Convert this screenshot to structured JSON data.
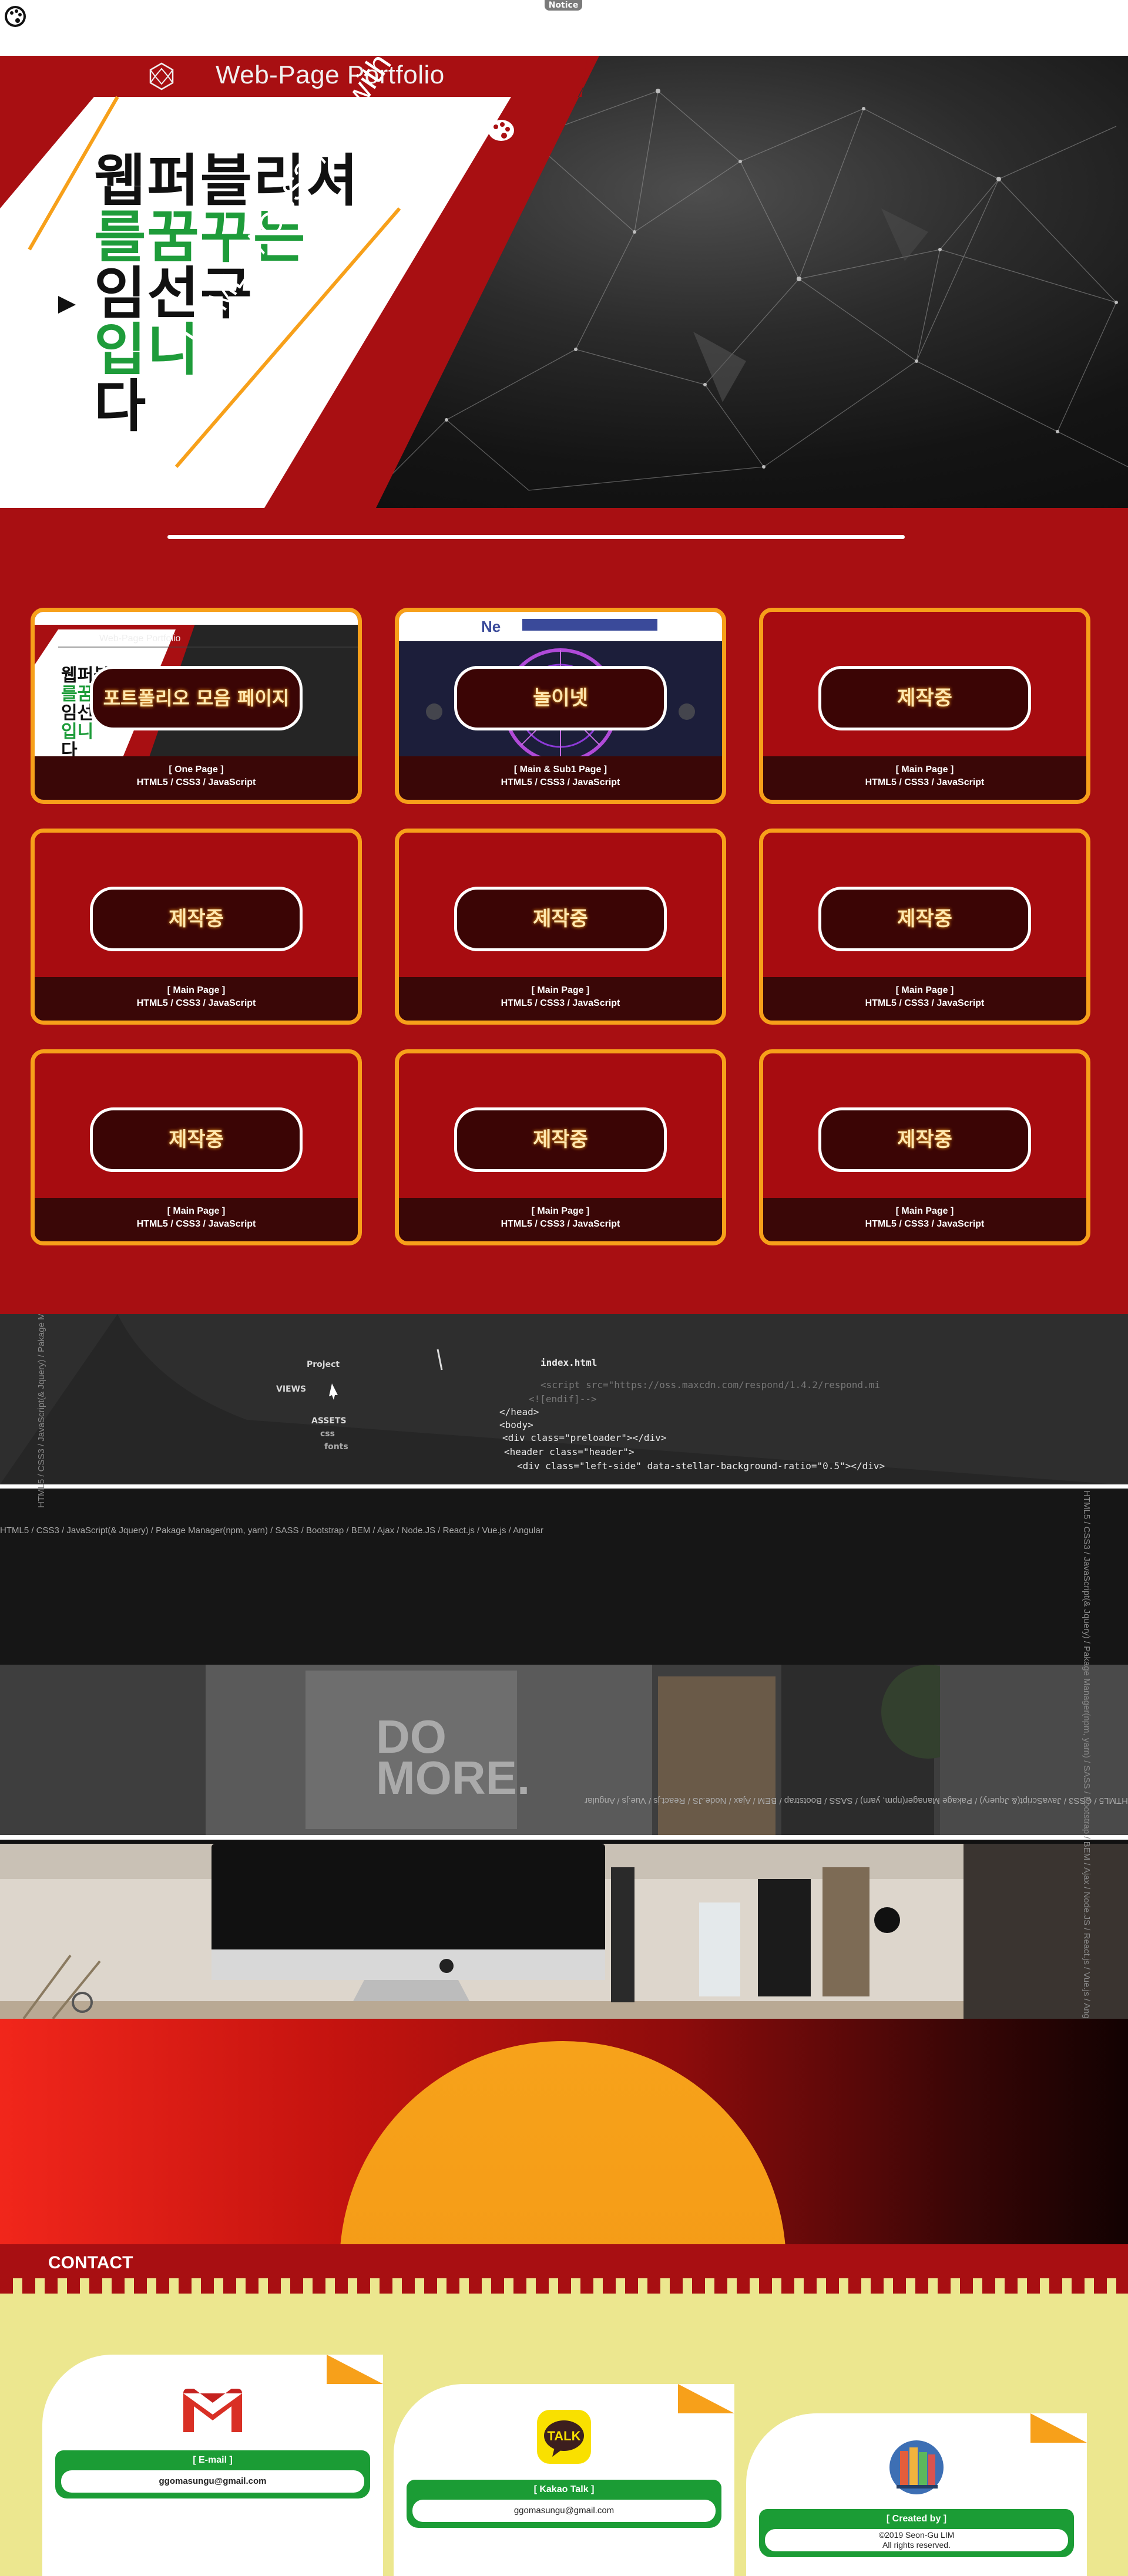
{
  "topbar": {
    "notice_label": "Notice",
    "logo_icon": "palette-icon"
  },
  "hero": {
    "title": "Web-Page Portfolio",
    "title_icon": "geodesic-sphere-icon",
    "headline_lines": [
      "웹퍼블리셔",
      "를꿈꾸는",
      "임선구",
      "입니",
      "다"
    ],
    "tech_stack": "HTML5 / CSS3 / JS(with Jquery)",
    "colors": {
      "red": "#a80f12",
      "green": "#1e9c3a",
      "orange": "#f7a01a"
    }
  },
  "portfolio": {
    "cards": [
      {
        "label": "포트폴리오 모음 페이지",
        "kind": "[ One Page ]",
        "tech": "HTML5 / CSS3 / JavaScript",
        "thumb": "portfolio"
      },
      {
        "label": "놀이넷",
        "kind": "[ Main & Sub1 Page ]",
        "tech": "HTML5 / CSS3 / JavaScript",
        "thumb": "noli"
      },
      {
        "label": "제작중",
        "kind": "[ Main Page ]",
        "tech": "HTML5 / CSS3 / JavaScript",
        "thumb": ""
      },
      {
        "label": "제작중",
        "kind": "[ Main Page ]",
        "tech": "HTML5 / CSS3 / JavaScript",
        "thumb": ""
      },
      {
        "label": "제작중",
        "kind": "[ Main Page ]",
        "tech": "HTML5 / CSS3 / JavaScript",
        "thumb": ""
      },
      {
        "label": "제작중",
        "kind": "[ Main Page ]",
        "tech": "HTML5 / CSS3 / JavaScript",
        "thumb": ""
      },
      {
        "label": "제작중",
        "kind": "[ Main Page ]",
        "tech": "HTML5 / CSS3 / JavaScript",
        "thumb": ""
      },
      {
        "label": "제작중",
        "kind": "[ Main Page ]",
        "tech": "HTML5 / CSS3 / JavaScript",
        "thumb": ""
      },
      {
        "label": "제작중",
        "kind": "[ Main Page ]",
        "tech": "HTML5 / CSS3 / JavaScript",
        "thumb": ""
      }
    ]
  },
  "code_strip": {
    "project_label": "Project",
    "views_label": "VIEWS",
    "assets_label": "ASSETS",
    "css_label": "css",
    "fonts_label": "fonts",
    "file_label": "index.html",
    "code_lines": [
      "<script src=\"https://oss.maxcdn.com/respond/1.4.2/respond.mi",
      "<![endif]-->",
      "</head>",
      "<body>",
      "<div class=\"preloader\"></div>",
      "<header class=\"header\">",
      "<div class=\"left-side\" data-stellar-background-ratio=\"0.5\"></div>"
    ]
  },
  "skills_marquee": "HTML5 / CSS3 / JavaScript(& Jquery) / Pakage Manager(npm, yarn) / SASS / Bootstrap / BEM / Ajax / Node.JS / React.js / Vue.js / Angular",
  "poster_text": "DO MORE.",
  "contact": {
    "title": "CONTACT",
    "cards": [
      {
        "icon": "gmail-icon",
        "heading": "[ E-mail ]",
        "lines": [
          "ggomasungu@gmail.com"
        ]
      },
      {
        "icon": "kakaotalk-icon",
        "heading": "[ Kakao Talk ]",
        "lines": [
          "ggomasungu@gmail.com"
        ],
        "icon_text": "TALK"
      },
      {
        "icon": "books-icon",
        "heading": "[ Created by ]",
        "lines": [
          "©2019 Seon-Gu LIM",
          "All rights reserved."
        ]
      }
    ]
  }
}
